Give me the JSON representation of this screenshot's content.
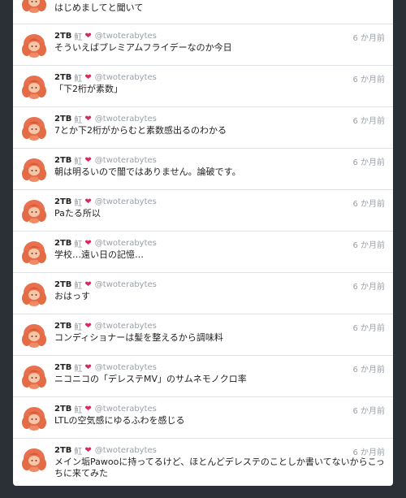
{
  "account": {
    "name": "2TB",
    "handle": "@twoterabytes",
    "badge_symbol": "魟",
    "heart_symbol": "❤"
  },
  "colors": {
    "background": "#2b2f36",
    "card": "#ffffff",
    "heart": "#e0245e",
    "avatar_hair": "#e8704e"
  },
  "partial_post": {
    "text": "はじめましてと聞いて"
  },
  "posts": [
    {
      "time": "6 か月前",
      "text": "そういえばプレミアムフライデーなのか今日"
    },
    {
      "time": "6 か月前",
      "text": "「下2桁が素数」"
    },
    {
      "time": "6 か月前",
      "text": "7とか下2桁がからむと素数感出るのわかる"
    },
    {
      "time": "6 か月前",
      "text": "朝は明るいので闇ではありません。論破です。"
    },
    {
      "time": "6 か月前",
      "text": "Paたる所以"
    },
    {
      "time": "6 か月前",
      "text": "学校…遠い日の記憶…"
    },
    {
      "time": "6 か月前",
      "text": "おはっす"
    },
    {
      "time": "6 か月前",
      "text": "コンディショナーは髪を整えるから調味料"
    },
    {
      "time": "6 か月前",
      "text": "ニコニコの「デレステMV」のサムネモノクロ率"
    },
    {
      "time": "6 か月前",
      "text": "LTLの空気感にゆるふわを感じる"
    },
    {
      "time": "6 か月前",
      "text": "メイン垢Pawooに持ってるけど、ほとんどデレステのことしか書いてないからこっちに来てみた"
    }
  ]
}
